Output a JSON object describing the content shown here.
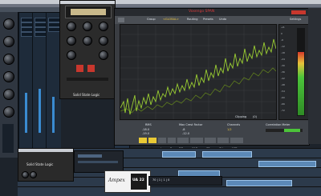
{
  "colors": {
    "accent": "#c8372d",
    "spectrum": "#9acd32",
    "meter_green": "#4cc43a",
    "meter_red": "#d63a2a",
    "uad_blue": "#3a8bd1"
  },
  "daw": {
    "menu": [
      "File",
      "Edit",
      "Project",
      "Audio",
      "MIDI",
      "Media",
      "Transport",
      "Devices",
      "Window",
      "Help"
    ],
    "daw_window_title": "Nuendo Project",
    "transport_time": "70 | 1 | 1 |  0"
  },
  "plugin_left": {
    "title": "Solid State Logic",
    "brand_line": "Solid State Logic"
  },
  "span": {
    "title": "Voxengo SPAN",
    "menu": [
      "Routing",
      "Presets",
      "Undo"
    ],
    "group_label": "Group",
    "preset_field": "<GLOBAL>",
    "settings_label": "Settings",
    "left_stats": {
      "rms_label": "RMS",
      "val_a": "-18.0",
      "val_b": "-19.0"
    },
    "center_stats": {
      "label": "Max Crest Factor",
      "val_a": "-8",
      "val_b": "-12.0"
    },
    "clipping_label": "Clipping",
    "clipping_val": "(0)",
    "channels_label": "Channels",
    "channels_val": "1/2",
    "correlation_label": "Correlation Meter",
    "db_scale": [
      "+6",
      "0",
      "-6",
      "-12",
      "-18",
      "-24",
      "-30",
      "-36",
      "-42",
      "-48",
      "-54",
      "-60",
      "-66",
      "-72"
    ],
    "freq_ticks": [
      "30",
      "100",
      "200",
      "500",
      "1K",
      "2K",
      "5K",
      "10K",
      "20K"
    ],
    "mode_buttons": [
      "M",
      "S",
      "L",
      "R",
      "DB",
      "CAP",
      "SP",
      "SV",
      "MID"
    ]
  },
  "uad": {
    "logo_script": "Ampex",
    "logo_block": "UA 22"
  }
}
